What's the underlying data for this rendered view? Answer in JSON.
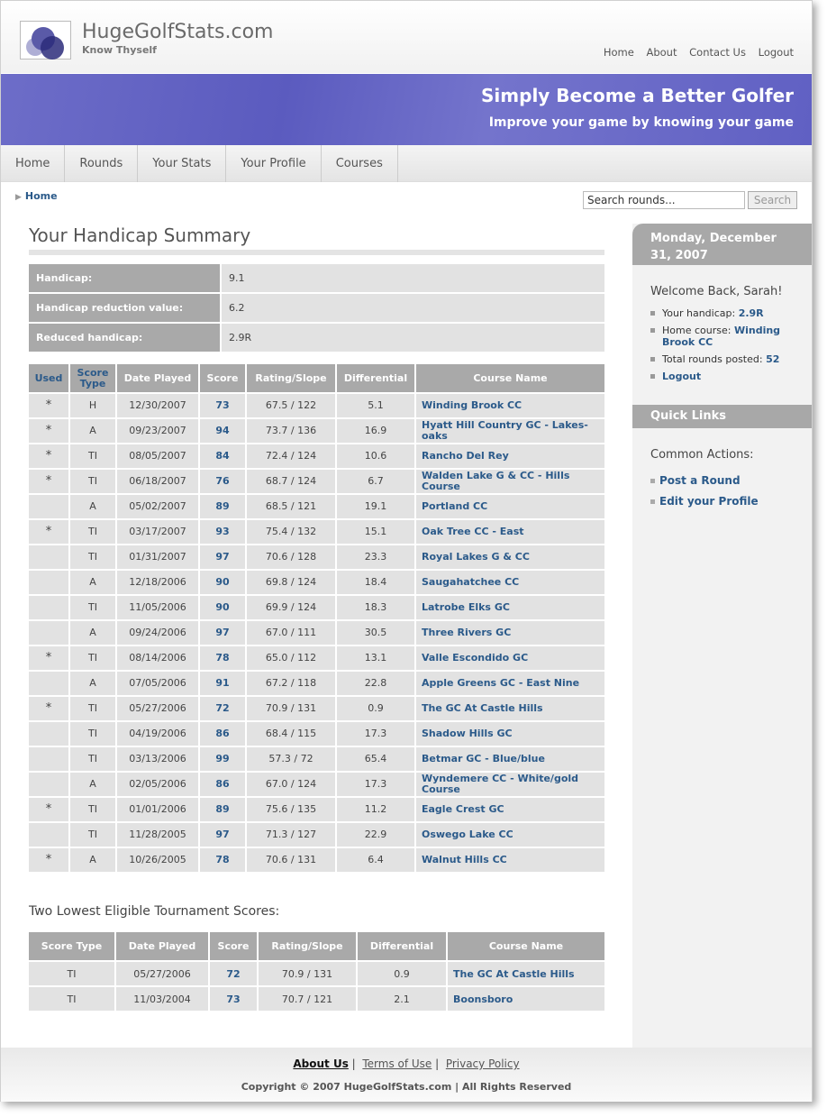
{
  "site": {
    "name": "HugeGolfStats.com",
    "tagline": "Know Thyself"
  },
  "top_nav": [
    "Home",
    "About",
    "Contact Us",
    "Logout"
  ],
  "banner": {
    "headline": "Simply Become a Better Golfer",
    "subline": "Improve your game by knowing your game"
  },
  "main_nav": [
    "Home",
    "Rounds",
    "Your Stats",
    "Your Profile",
    "Courses"
  ],
  "breadcrumb": "Home",
  "search": {
    "value": "Search rounds...",
    "button": "Search"
  },
  "page_title": "Your Handicap Summary",
  "summary": [
    {
      "label": "Handicap:",
      "value": "9.1"
    },
    {
      "label": "Handicap reduction value:",
      "value": "6.2"
    },
    {
      "label": "Reduced handicap:",
      "value": "2.9R"
    }
  ],
  "rounds_table": {
    "headers": [
      "Used",
      "Score Type",
      "Date Played",
      "Score",
      "Rating/Slope",
      "Differential",
      "Course Name"
    ],
    "rows": [
      {
        "used": "*",
        "type": "H",
        "date": "12/30/2007",
        "score": "73",
        "rating": "67.5 / 122",
        "diff": "5.1",
        "course": "Winding Brook CC"
      },
      {
        "used": "*",
        "type": "A",
        "date": "09/23/2007",
        "score": "94",
        "rating": "73.7 / 136",
        "diff": "16.9",
        "course": "Hyatt Hill Country GC - Lakes-oaks"
      },
      {
        "used": "*",
        "type": "TI",
        "date": "08/05/2007",
        "score": "84",
        "rating": "72.4 / 124",
        "diff": "10.6",
        "course": "Rancho Del Rey"
      },
      {
        "used": "*",
        "type": "TI",
        "date": "06/18/2007",
        "score": "76",
        "rating": "68.7 / 124",
        "diff": "6.7",
        "course": "Walden Lake G & CC - Hills Course"
      },
      {
        "used": "",
        "type": "A",
        "date": "05/02/2007",
        "score": "89",
        "rating": "68.5 / 121",
        "diff": "19.1",
        "course": "Portland CC"
      },
      {
        "used": "*",
        "type": "TI",
        "date": "03/17/2007",
        "score": "93",
        "rating": "75.4 / 132",
        "diff": "15.1",
        "course": "Oak Tree CC - East"
      },
      {
        "used": "",
        "type": "TI",
        "date": "01/31/2007",
        "score": "97",
        "rating": "70.6 / 128",
        "diff": "23.3",
        "course": "Royal Lakes G & CC"
      },
      {
        "used": "",
        "type": "A",
        "date": "12/18/2006",
        "score": "90",
        "rating": "69.8 / 124",
        "diff": "18.4",
        "course": "Saugahatchee CC"
      },
      {
        "used": "",
        "type": "TI",
        "date": "11/05/2006",
        "score": "90",
        "rating": "69.9 / 124",
        "diff": "18.3",
        "course": "Latrobe Elks GC"
      },
      {
        "used": "",
        "type": "A",
        "date": "09/24/2006",
        "score": "97",
        "rating": "67.0 / 111",
        "diff": "30.5",
        "course": "Three Rivers GC"
      },
      {
        "used": "*",
        "type": "TI",
        "date": "08/14/2006",
        "score": "78",
        "rating": "65.0 / 112",
        "diff": "13.1",
        "course": "Valle Escondido GC"
      },
      {
        "used": "",
        "type": "A",
        "date": "07/05/2006",
        "score": "91",
        "rating": "67.2 / 118",
        "diff": "22.8",
        "course": "Apple Greens GC - East Nine"
      },
      {
        "used": "*",
        "type": "TI",
        "date": "05/27/2006",
        "score": "72",
        "rating": "70.9 / 131",
        "diff": "0.9",
        "course": "The GC At Castle Hills"
      },
      {
        "used": "",
        "type": "TI",
        "date": "04/19/2006",
        "score": "86",
        "rating": "68.4 / 115",
        "diff": "17.3",
        "course": "Shadow Hills GC"
      },
      {
        "used": "",
        "type": "TI",
        "date": "03/13/2006",
        "score": "99",
        "rating": "57.3 / 72",
        "diff": "65.4",
        "course": "Betmar GC - Blue/blue"
      },
      {
        "used": "",
        "type": "A",
        "date": "02/05/2006",
        "score": "86",
        "rating": "67.0 / 124",
        "diff": "17.3",
        "course": "Wyndemere CC - White/gold Course"
      },
      {
        "used": "*",
        "type": "TI",
        "date": "01/01/2006",
        "score": "89",
        "rating": "75.6 / 135",
        "diff": "11.2",
        "course": "Eagle Crest GC"
      },
      {
        "used": "",
        "type": "TI",
        "date": "11/28/2005",
        "score": "97",
        "rating": "71.3 / 127",
        "diff": "22.9",
        "course": "Oswego Lake CC"
      },
      {
        "used": "*",
        "type": "A",
        "date": "10/26/2005",
        "score": "78",
        "rating": "70.6 / 131",
        "diff": "6.4",
        "course": "Walnut Hills CC"
      }
    ]
  },
  "tournament": {
    "heading": "Two Lowest Eligible Tournament Scores:",
    "headers": [
      "Score Type",
      "Date Played",
      "Score",
      "Rating/Slope",
      "Differential",
      "Course Name"
    ],
    "rows": [
      {
        "type": "TI",
        "date": "05/27/2006",
        "score": "72",
        "rating": "70.9 / 131",
        "diff": "0.9",
        "course": "The GC At Castle Hills"
      },
      {
        "type": "TI",
        "date": "11/03/2004",
        "score": "73",
        "rating": "70.7 / 121",
        "diff": "2.1",
        "course": "Boonsboro"
      }
    ]
  },
  "sidebar": {
    "date": "Monday, December 31, 2007",
    "welcome": "Welcome Back, Sarah!",
    "handicap_label": "Your handicap:",
    "handicap_value": "2.9R",
    "home_label": "Home course:",
    "home_value": "Winding Brook CC",
    "rounds_label": "Total rounds posted:",
    "rounds_value": "52",
    "logout": "Logout",
    "quick_links": "Quick Links",
    "common_actions": "Common Actions:",
    "actions": [
      "Post a Round",
      "Edit your Profile"
    ]
  },
  "footer": {
    "links": [
      "About Us",
      "Terms of Use",
      "Privacy Policy"
    ],
    "copyright": "Copyright © 2007 HugeGolfStats.com | All Rights Reserved"
  },
  "colors": {
    "banner": "#6060c3",
    "link": "#2b5a8a",
    "header_cell": "#a9a9a9",
    "cell": "#e2e2e2"
  }
}
